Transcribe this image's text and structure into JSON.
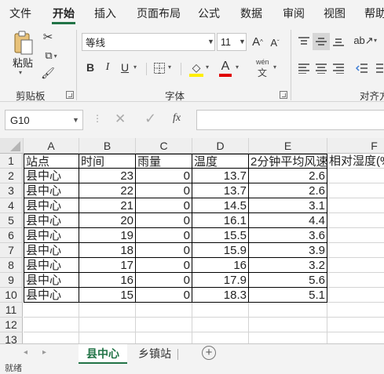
{
  "menu": {
    "tabs": [
      "文件",
      "开始",
      "插入",
      "页面布局",
      "公式",
      "数据",
      "审阅",
      "视图",
      "帮助"
    ],
    "active_tab": "开始"
  },
  "ribbon": {
    "clipboard": {
      "paste_label": "粘贴",
      "group_label": "剪贴板"
    },
    "font": {
      "font_name": "等线",
      "font_size": "11",
      "group_label": "字体",
      "bold": "B",
      "italic": "I",
      "underline": "U",
      "phonetic": "wén",
      "font_color": "#e00000",
      "highlight_color": "#ffee00"
    },
    "alignment": {
      "group_label": "对齐方"
    }
  },
  "formula_bar": {
    "name_box": "G10",
    "fx_label": "fx",
    "value": ""
  },
  "sheet": {
    "columns": [
      "A",
      "B",
      "C",
      "D",
      "E",
      "F"
    ],
    "rows": [
      "1",
      "2",
      "3",
      "4",
      "5",
      "6",
      "7",
      "8",
      "9",
      "10",
      "11",
      "12",
      "13"
    ],
    "headers": [
      "站点",
      "时间",
      "雨量",
      "温度",
      "2分钟平均风速",
      "相对湿度(%"
    ],
    "data": [
      [
        "县中心",
        "23",
        "0",
        "13.7",
        "2.6",
        ""
      ],
      [
        "县中心",
        "22",
        "0",
        "13.7",
        "2.6",
        ""
      ],
      [
        "县中心",
        "21",
        "0",
        "14.5",
        "3.1",
        ""
      ],
      [
        "县中心",
        "20",
        "0",
        "16.1",
        "4.4",
        ""
      ],
      [
        "县中心",
        "19",
        "0",
        "15.5",
        "3.6",
        ""
      ],
      [
        "县中心",
        "18",
        "0",
        "15.9",
        "3.9",
        ""
      ],
      [
        "县中心",
        "17",
        "0",
        "16",
        "3.2",
        ""
      ],
      [
        "县中心",
        "16",
        "0",
        "17.9",
        "5.6",
        ""
      ],
      [
        "县中心",
        "15",
        "0",
        "18.3",
        "5.1",
        ""
      ]
    ]
  },
  "sheet_tabs": [
    "县中心",
    "乡镇站"
  ],
  "active_sheet": "县中心",
  "status": "就绪",
  "colors": {
    "accent": "#217346"
  }
}
